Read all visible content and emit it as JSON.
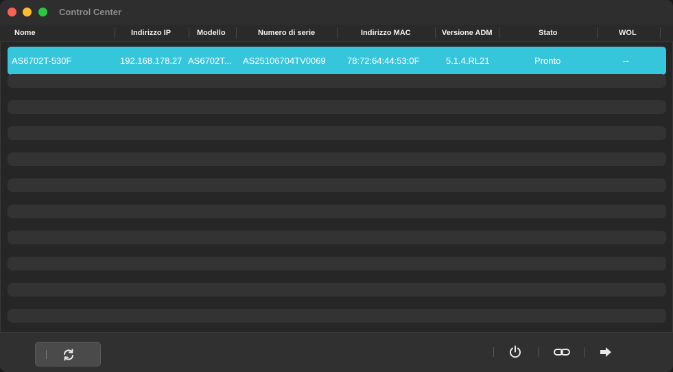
{
  "window": {
    "title": "Control Center"
  },
  "columns": [
    "Nome",
    "Indirizzo IP",
    "Modello",
    "Numero di serie",
    "Indirizzo MAC",
    "Versione ADM",
    "Stato",
    "WOL"
  ],
  "devices": [
    {
      "name": "AS6702T-530F",
      "ip": "192.168.178.27",
      "model": "AS6702T...",
      "serial": "AS25106704TV0069",
      "mac": "78:72:64:44:53:0F",
      "adm": "5.1.4.RL21",
      "status": "Pronto",
      "wol": "--"
    }
  ],
  "footer": {
    "icons": [
      "refresh-icon",
      "power-icon",
      "link-icon",
      "arrow-right-icon"
    ]
  },
  "colors": {
    "selection": "#36c6dc",
    "close": "#fe5f57",
    "minimize": "#febc2e",
    "maximize": "#28c840"
  }
}
